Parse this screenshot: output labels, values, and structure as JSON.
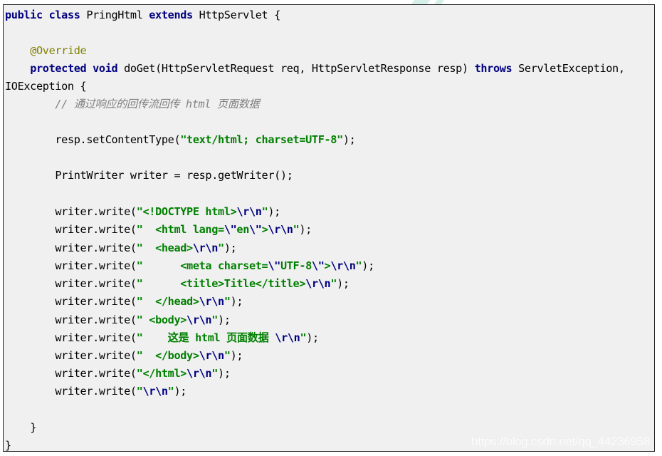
{
  "document": {
    "type": "java-source-code",
    "language": "Java",
    "lines": [
      {
        "indent": "",
        "tokens": [
          {
            "t": "kw",
            "v": "public"
          },
          {
            "t": "plain",
            "v": " "
          },
          {
            "t": "kw",
            "v": "class"
          },
          {
            "t": "plain",
            "v": " PringHtml "
          },
          {
            "t": "kw",
            "v": "extends"
          },
          {
            "t": "plain",
            "v": " HttpServlet {"
          }
        ]
      },
      {
        "indent": "",
        "tokens": []
      },
      {
        "indent": "    ",
        "tokens": [
          {
            "t": "ann",
            "v": "@Override"
          }
        ]
      },
      {
        "indent": "    ",
        "tokens": [
          {
            "t": "kw",
            "v": "protected"
          },
          {
            "t": "plain",
            "v": " "
          },
          {
            "t": "kw",
            "v": "void"
          },
          {
            "t": "plain",
            "v": " doGet(HttpServletRequest req, HttpServletResponse resp) "
          },
          {
            "t": "kw",
            "v": "throws"
          },
          {
            "t": "plain",
            "v": " ServletException,"
          }
        ]
      },
      {
        "indent": "",
        "tokens": [
          {
            "t": "plain",
            "v": "IOException {"
          }
        ]
      },
      {
        "indent": "        ",
        "tokens": [
          {
            "t": "comment",
            "v": "// 通过响应的回传流回传 html 页面数据"
          }
        ]
      },
      {
        "indent": "",
        "tokens": []
      },
      {
        "indent": "        ",
        "tokens": [
          {
            "t": "plain",
            "v": "resp.setContentType("
          },
          {
            "t": "str",
            "v": "\"text/html; charset=UTF-8\""
          },
          {
            "t": "plain",
            "v": ");"
          }
        ]
      },
      {
        "indent": "",
        "tokens": []
      },
      {
        "indent": "        ",
        "tokens": [
          {
            "t": "plain",
            "v": "PrintWriter writer = resp.getWriter();"
          }
        ]
      },
      {
        "indent": "",
        "tokens": []
      },
      {
        "indent": "        ",
        "tokens": [
          {
            "t": "plain",
            "v": "writer.write("
          },
          {
            "t": "str",
            "v": "\"<!DOCTYPE html>"
          },
          {
            "t": "esc",
            "v": "\\r\\n"
          },
          {
            "t": "str",
            "v": "\""
          },
          {
            "t": "plain",
            "v": ");"
          }
        ]
      },
      {
        "indent": "        ",
        "tokens": [
          {
            "t": "plain",
            "v": "writer.write("
          },
          {
            "t": "str",
            "v": "\"  <html lang="
          },
          {
            "t": "esc",
            "v": "\\\""
          },
          {
            "t": "str",
            "v": "en"
          },
          {
            "t": "esc",
            "v": "\\\""
          },
          {
            "t": "str",
            "v": ">"
          },
          {
            "t": "esc",
            "v": "\\r\\n"
          },
          {
            "t": "str",
            "v": "\""
          },
          {
            "t": "plain",
            "v": ");"
          }
        ]
      },
      {
        "indent": "        ",
        "tokens": [
          {
            "t": "plain",
            "v": "writer.write("
          },
          {
            "t": "str",
            "v": "\"  <head>"
          },
          {
            "t": "esc",
            "v": "\\r\\n"
          },
          {
            "t": "str",
            "v": "\""
          },
          {
            "t": "plain",
            "v": ");"
          }
        ]
      },
      {
        "indent": "        ",
        "tokens": [
          {
            "t": "plain",
            "v": "writer.write("
          },
          {
            "t": "str",
            "v": "\"      <meta charset="
          },
          {
            "t": "esc",
            "v": "\\\""
          },
          {
            "t": "str",
            "v": "UTF-8"
          },
          {
            "t": "esc",
            "v": "\\\""
          },
          {
            "t": "str",
            "v": ">"
          },
          {
            "t": "esc",
            "v": "\\r\\n"
          },
          {
            "t": "str",
            "v": "\""
          },
          {
            "t": "plain",
            "v": ");"
          }
        ]
      },
      {
        "indent": "        ",
        "tokens": [
          {
            "t": "plain",
            "v": "writer.write("
          },
          {
            "t": "str",
            "v": "\"      <title>Title</title>"
          },
          {
            "t": "esc",
            "v": "\\r\\n"
          },
          {
            "t": "str",
            "v": "\""
          },
          {
            "t": "plain",
            "v": ");"
          }
        ]
      },
      {
        "indent": "        ",
        "tokens": [
          {
            "t": "plain",
            "v": "writer.write("
          },
          {
            "t": "str",
            "v": "\"  </head>"
          },
          {
            "t": "esc",
            "v": "\\r\\n"
          },
          {
            "t": "str",
            "v": "\""
          },
          {
            "t": "plain",
            "v": ");"
          }
        ]
      },
      {
        "indent": "        ",
        "tokens": [
          {
            "t": "plain",
            "v": "writer.write("
          },
          {
            "t": "str",
            "v": "\" <body>"
          },
          {
            "t": "esc",
            "v": "\\r\\n"
          },
          {
            "t": "str",
            "v": "\""
          },
          {
            "t": "plain",
            "v": ");"
          }
        ]
      },
      {
        "indent": "        ",
        "tokens": [
          {
            "t": "plain",
            "v": "writer.write("
          },
          {
            "t": "str",
            "v": "\"    这是 html 页面数据 "
          },
          {
            "t": "esc",
            "v": "\\r\\n"
          },
          {
            "t": "str",
            "v": "\""
          },
          {
            "t": "plain",
            "v": ");"
          }
        ]
      },
      {
        "indent": "        ",
        "tokens": [
          {
            "t": "plain",
            "v": "writer.write("
          },
          {
            "t": "str",
            "v": "\"  </body>"
          },
          {
            "t": "esc",
            "v": "\\r\\n"
          },
          {
            "t": "str",
            "v": "\""
          },
          {
            "t": "plain",
            "v": ");"
          }
        ]
      },
      {
        "indent": "        ",
        "tokens": [
          {
            "t": "plain",
            "v": "writer.write("
          },
          {
            "t": "str",
            "v": "\"</html>"
          },
          {
            "t": "esc",
            "v": "\\r\\n"
          },
          {
            "t": "str",
            "v": "\""
          },
          {
            "t": "plain",
            "v": ");"
          }
        ]
      },
      {
        "indent": "        ",
        "tokens": [
          {
            "t": "plain",
            "v": "writer.write("
          },
          {
            "t": "str",
            "v": "\""
          },
          {
            "t": "esc",
            "v": "\\r\\n"
          },
          {
            "t": "str",
            "v": "\""
          },
          {
            "t": "plain",
            "v": ");"
          }
        ]
      },
      {
        "indent": "",
        "tokens": []
      },
      {
        "indent": "    ",
        "tokens": [
          {
            "t": "plain",
            "v": "}"
          }
        ]
      },
      {
        "indent": "",
        "tokens": [
          {
            "t": "plain",
            "v": "}"
          }
        ]
      }
    ]
  },
  "watermark": {
    "text": "https://blog.csdn.net/qq_44236958"
  },
  "colors": {
    "background": "#f0f0f0",
    "keyword": "#000080",
    "annotation": "#808000",
    "comment": "#808080",
    "string": "#008000",
    "escape": "#000080",
    "plain": "#000000"
  }
}
